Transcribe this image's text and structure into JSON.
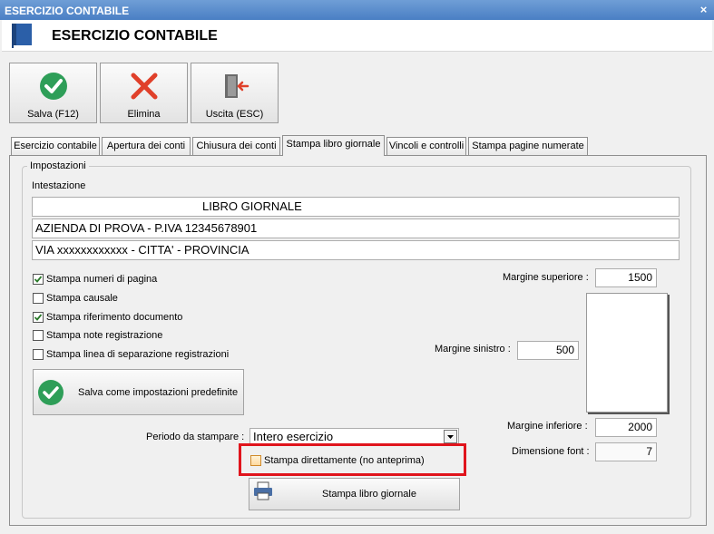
{
  "window": {
    "title": "ESERCIZIO CONTABILE",
    "close_glyph": "×"
  },
  "header": {
    "title": "ESERCIZIO CONTABILE",
    "icon": "book-icon"
  },
  "toolbar": {
    "save_label": "Salva (F12)",
    "delete_label": "Elimina",
    "exit_label": "Uscita (ESC)"
  },
  "tabs": [
    {
      "label": "Esercizio contabile"
    },
    {
      "label": "Apertura dei conti"
    },
    {
      "label": "Chiusura dei conti"
    },
    {
      "label": "Stampa libro giornale",
      "active": true
    },
    {
      "label": "Vincoli e controlli"
    },
    {
      "label": "Stampa pagine numerate"
    }
  ],
  "settings": {
    "group_label": "Impostazioni",
    "intestazione_label": "Intestazione",
    "lines": [
      "LIBRO GIORNALE",
      "AZIENDA DI PROVA - P.IVA 12345678901",
      "VIA xxxxxxxxxxxx - CITTA' - PROVINCIA"
    ],
    "checkboxes": [
      {
        "label": "Stampa numeri di pagina",
        "checked": true
      },
      {
        "label": "Stampa causale",
        "checked": false
      },
      {
        "label": "Stampa riferimento documento",
        "checked": true
      },
      {
        "label": "Stampa note registrazione",
        "checked": false
      },
      {
        "label": "Stampa linea di separazione registrazioni",
        "checked": false
      }
    ],
    "save_default_label": "Salva come impostazioni predefinite",
    "margins": {
      "top_label": "Margine superiore :",
      "top_value": "1500",
      "left_label": "Margine sinistro :",
      "left_value": "500",
      "bottom_label": "Margine inferiore :",
      "bottom_value": "2000",
      "font_label": "Dimensione font :",
      "font_value": "7"
    },
    "period_label": "Periodo da stampare :",
    "period_value": "Intero esercizio",
    "direct_print_label": "Stampa direttamente (no anteprima)",
    "direct_print_checked": false,
    "print_button_label": "Stampa libro giornale"
  },
  "colors": {
    "highlight": "#e0141c",
    "accent_green": "#2e9e58",
    "delete_red": "#e0402a"
  }
}
